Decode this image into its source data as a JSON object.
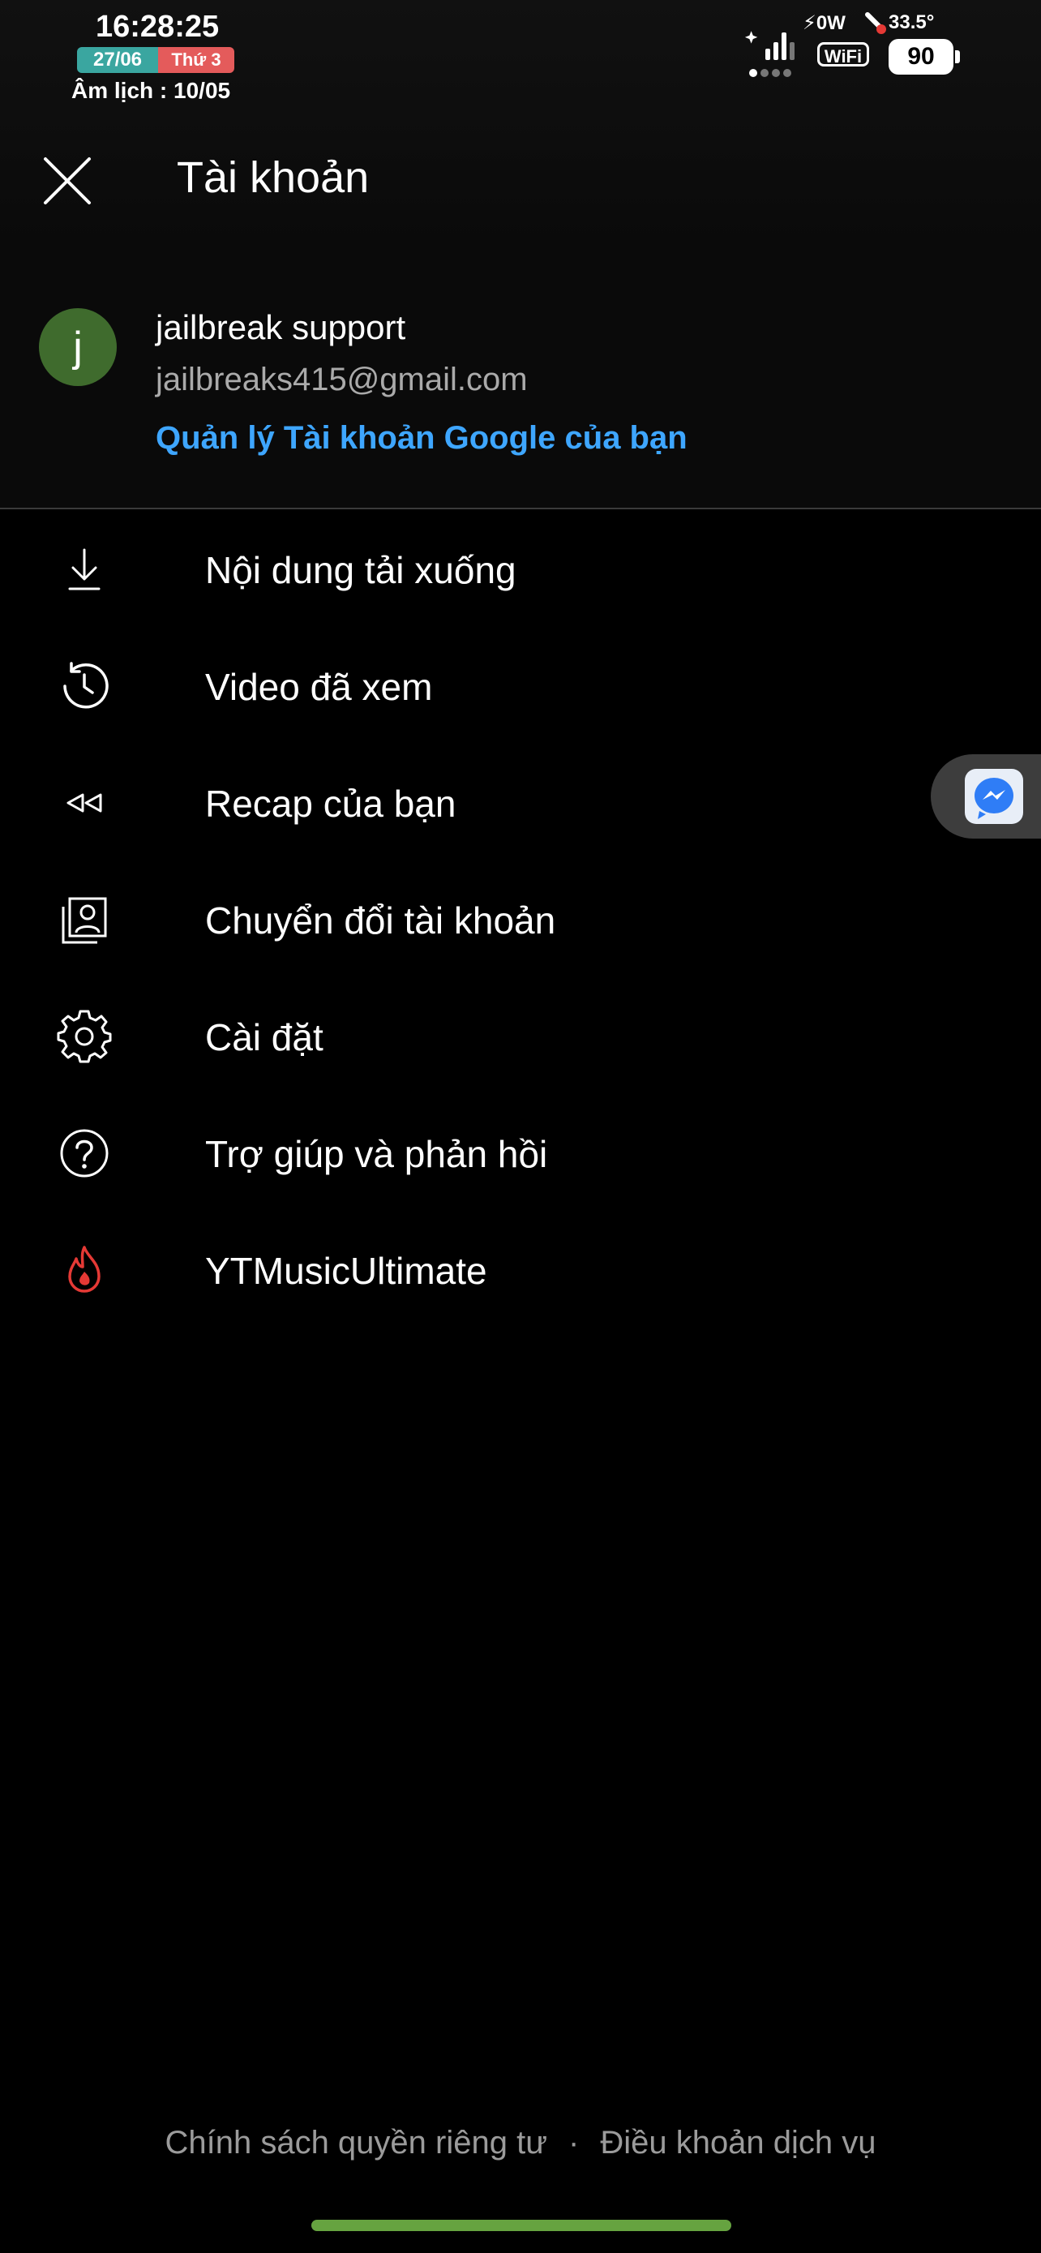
{
  "status_bar": {
    "time": "16:28:25",
    "date": "27/06",
    "weekday": "Thứ 3",
    "lunar": "Âm lịch : 10/05",
    "power": "⚡0W",
    "temperature": "33.5°",
    "wifi_label": "WiFi",
    "battery": "90"
  },
  "header": {
    "title": "Tài khoản"
  },
  "account": {
    "avatar_letter": "j",
    "avatar_color": "#3f6b2d",
    "name": "jailbreak support",
    "email": "jailbreaks415@gmail.com",
    "manage_link": "Quản lý Tài khoản Google của bạn",
    "link_color": "#3ea6ff"
  },
  "menu": {
    "items": [
      {
        "label": "Nội dung tải xuống",
        "icon": "download-icon"
      },
      {
        "label": "Video đã xem",
        "icon": "history-icon"
      },
      {
        "label": "Recap của bạn",
        "icon": "rewind-icon"
      },
      {
        "label": "Chuyển đổi tài khoản",
        "icon": "switch-account-icon"
      },
      {
        "label": "Cài đặt",
        "icon": "gear-icon"
      },
      {
        "label": "Trợ giúp và phản hồi",
        "icon": "help-icon"
      },
      {
        "label": "YTMusicUltimate",
        "icon": "flame-icon"
      }
    ]
  },
  "footer": {
    "privacy": "Chính sách quyền riêng tư",
    "separator": "·",
    "terms": "Điều khoản dịch vụ"
  },
  "colors": {
    "background": "#000000",
    "home_indicator": "#66a340",
    "flame_icon": "#e53935"
  }
}
